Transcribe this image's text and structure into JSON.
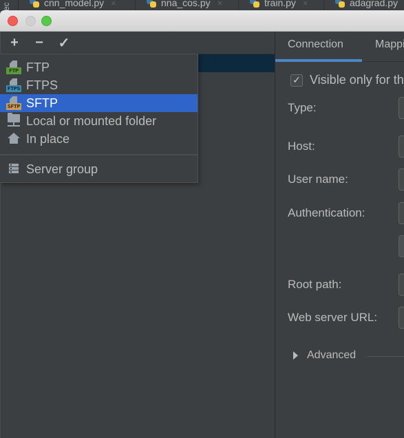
{
  "editor_tabs": {
    "side_label": "ec",
    "tabs": [
      {
        "label": "cnn_model.py"
      },
      {
        "label": "nna_cos.py"
      },
      {
        "label": "train.py"
      },
      {
        "label": "adagrad.py"
      }
    ],
    "close_glyph": "×"
  },
  "toolbar": {
    "add": "+",
    "remove": "−",
    "apply": "✓"
  },
  "add_menu": {
    "items": [
      {
        "label": "FTP",
        "icon": "ftp-icon",
        "tag": "FTP"
      },
      {
        "label": "FTPS",
        "icon": "ftps-icon",
        "tag": "FTPS"
      },
      {
        "label": "SFTP",
        "icon": "sftp-icon",
        "tag": "SFTP",
        "selected": true
      },
      {
        "label": "Local or mounted folder",
        "icon": "folder-network-icon"
      },
      {
        "label": "In place",
        "icon": "home-icon"
      }
    ],
    "group_item": {
      "label": "Server group",
      "icon": "server-group-icon"
    }
  },
  "settings": {
    "tabs": [
      {
        "label": "Connection",
        "active": true
      },
      {
        "label": "Mappings"
      }
    ],
    "visible_only_checkbox": {
      "label": "Visible only for this project",
      "checked": true,
      "check_glyph": "✓"
    },
    "fields": [
      {
        "label": "Type:"
      },
      {
        "label": "Host:"
      },
      {
        "label": "User name:"
      },
      {
        "label": "Authentication:"
      },
      {
        "label": "Root path:"
      },
      {
        "label": "Web server URL:"
      }
    ],
    "advanced_label": "Advanced"
  },
  "colors": {
    "background": "#3c3f41",
    "selection": "#2f65ca",
    "tab_underline": "#4a88c7",
    "selected_server_row": "#0d293e"
  }
}
